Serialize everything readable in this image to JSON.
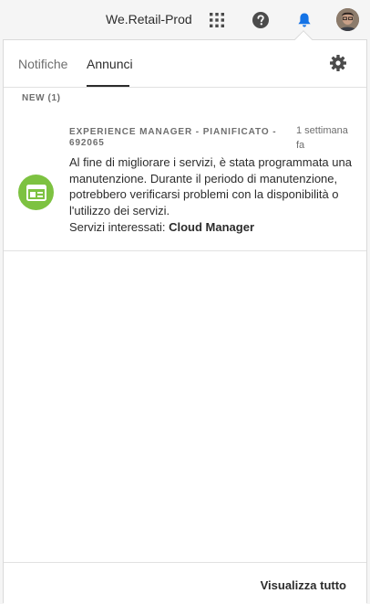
{
  "topbar": {
    "org_name": "We.Retail-Prod",
    "apps_icon": "apps-grid-icon",
    "help_icon": "help-icon",
    "bell_icon": "bell-icon",
    "bell_color": "#1473e6",
    "avatar": "user-avatar"
  },
  "tabs": [
    {
      "label": "Notifiche",
      "active": false
    },
    {
      "label": "Annunci",
      "active": true
    }
  ],
  "settings_icon": "gear-icon",
  "section": {
    "label": "NEW (1)"
  },
  "announcement": {
    "icon": "announcement-icon",
    "icon_color": "#7dc241",
    "title": "EXPERIENCE MANAGER - PIANIFICATO - 692065",
    "time": "1 settimana fa",
    "body": "Al fine di migliorare i servizi, è stata programmata una manutenzione. Durante il periodo di manutenzione, potrebbero verificarsi problemi con la disponibilità o l'utilizzo dei servizi.",
    "services_label": "Servizi interessati:",
    "services_value": "Cloud Manager"
  },
  "footer": {
    "view_all": "Visualizza tutto"
  }
}
